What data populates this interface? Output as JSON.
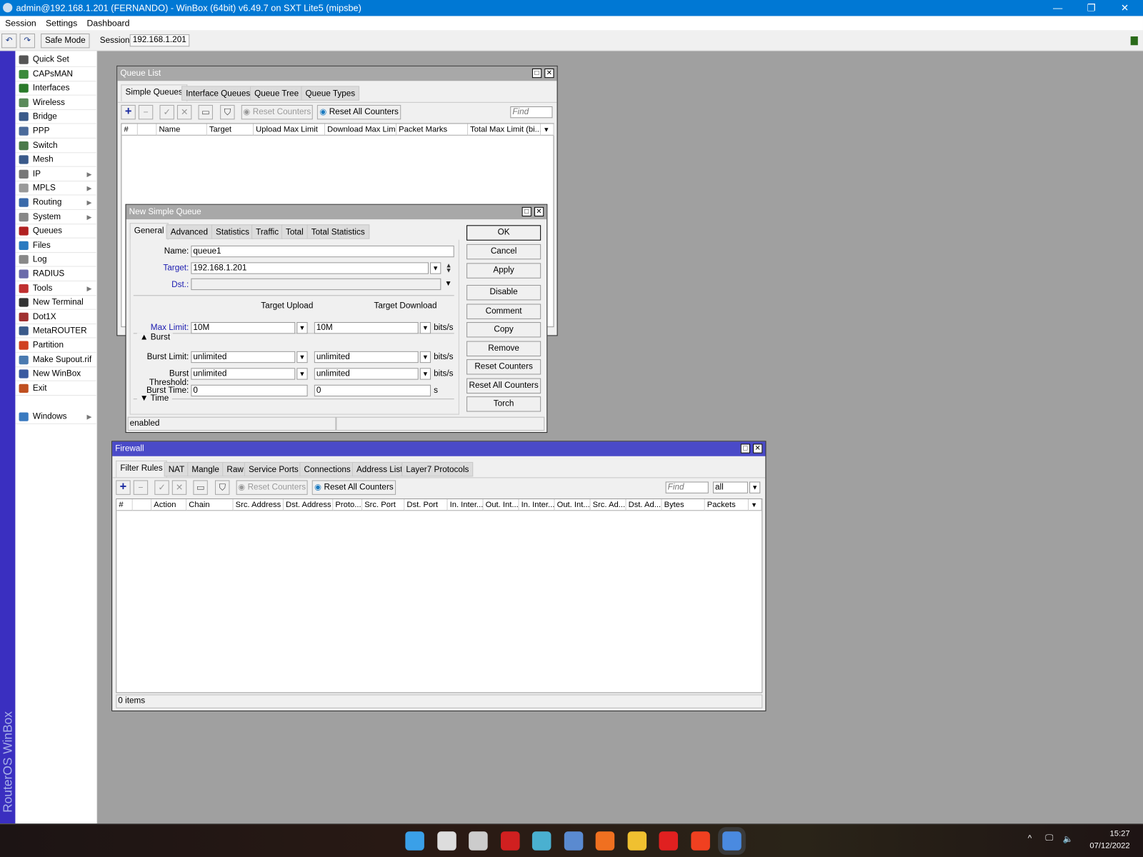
{
  "app": {
    "title": "admin@192.168.1.201 (FERNANDO) - WinBox (64bit) v6.49.7 on SXT Lite5 (mipsbe)",
    "menu": [
      "Session",
      "Settings",
      "Dashboard"
    ],
    "safe_mode": "Safe Mode",
    "session_label": "Session:",
    "session_value": "192.168.1.201",
    "brand": "RouterOS WinBox"
  },
  "sidebar": {
    "items": [
      {
        "label": "Quick Set",
        "icon": "wand-icon",
        "color": "#555"
      },
      {
        "label": "CAPsMAN",
        "icon": "antenna-icon",
        "color": "#3a8a3a"
      },
      {
        "label": "Interfaces",
        "icon": "interfaces-icon",
        "color": "#2a7a2a"
      },
      {
        "label": "Wireless",
        "icon": "wireless-icon",
        "color": "#5a8a5a"
      },
      {
        "label": "Bridge",
        "icon": "bridge-icon",
        "color": "#3a5a8a"
      },
      {
        "label": "PPP",
        "icon": "ppp-icon",
        "color": "#4a6a9a"
      },
      {
        "label": "Switch",
        "icon": "switch-icon",
        "color": "#4a7a4a"
      },
      {
        "label": "Mesh",
        "icon": "mesh-icon",
        "color": "#3a5a8a"
      },
      {
        "label": "IP",
        "icon": "ip-icon",
        "color": "#777",
        "sub": true
      },
      {
        "label": "MPLS",
        "icon": "mpls-icon",
        "color": "#999",
        "sub": true
      },
      {
        "label": "Routing",
        "icon": "routing-icon",
        "color": "#3a6aaa",
        "sub": true
      },
      {
        "label": "System",
        "icon": "gear-icon",
        "color": "#888",
        "sub": true
      },
      {
        "label": "Queues",
        "icon": "queues-icon",
        "color": "#b02020"
      },
      {
        "label": "Files",
        "icon": "folder-icon",
        "color": "#2a7ac0"
      },
      {
        "label": "Log",
        "icon": "log-icon",
        "color": "#888"
      },
      {
        "label": "RADIUS",
        "icon": "radius-icon",
        "color": "#6a6aaa"
      },
      {
        "label": "Tools",
        "icon": "tools-icon",
        "color": "#c03030",
        "sub": true
      },
      {
        "label": "New Terminal",
        "icon": "terminal-icon",
        "color": "#333"
      },
      {
        "label": "Dot1X",
        "icon": "dot1x-icon",
        "color": "#a03030"
      },
      {
        "label": "MetaROUTER",
        "icon": "metarouter-icon",
        "color": "#3a5a8a"
      },
      {
        "label": "Partition",
        "icon": "partition-icon",
        "color": "#d04020"
      },
      {
        "label": "Make Supout.rif",
        "icon": "supout-icon",
        "color": "#4a7ab0"
      },
      {
        "label": "New WinBox",
        "icon": "winbox-icon",
        "color": "#3a5aa0"
      },
      {
        "label": "Exit",
        "icon": "exit-icon",
        "color": "#c05020"
      }
    ],
    "windows": {
      "label": "Windows",
      "icon": "windows-icon",
      "color": "#3a7ac0"
    }
  },
  "queue_list": {
    "title": "Queue List",
    "tabs": [
      "Simple Queues",
      "Interface Queues",
      "Queue Tree",
      "Queue Types"
    ],
    "reset_counters": "Reset Counters",
    "reset_all_counters": "Reset All Counters",
    "find_placeholder": "Find",
    "columns": [
      "#",
      "",
      "Name",
      "Target",
      "Upload Max Limit",
      "Download Max Limit",
      "Packet Marks",
      "Total Max Limit (bi..."
    ]
  },
  "new_queue": {
    "title": "New Simple Queue",
    "tabs": [
      "General",
      "Advanced",
      "Statistics",
      "Traffic",
      "Total",
      "Total Statistics"
    ],
    "name_label": "Name:",
    "name": "queue1",
    "target_label": "Target:",
    "target": "192.168.1.201",
    "dst_label": "Dst.:",
    "dst": "",
    "upload_header": "Target Upload",
    "download_header": "Target Download",
    "max_limit_label": "Max Limit:",
    "max_upload": "10M",
    "max_download": "10M",
    "unit": "bits/s",
    "burst_section": "Burst",
    "burst_limit_label": "Burst Limit:",
    "burst_limit_up": "unlimited",
    "burst_limit_down": "unlimited",
    "burst_threshold_label": "Burst Threshold:",
    "burst_threshold_up": "unlimited",
    "burst_threshold_down": "unlimited",
    "burst_time_label": "Burst Time:",
    "burst_time_up": "0",
    "burst_time_down": "0",
    "time_unit": "s",
    "time_section": "Time",
    "buttons": [
      "OK",
      "Cancel",
      "Apply",
      "Disable",
      "Comment",
      "Copy",
      "Remove",
      "Reset Counters",
      "Reset All Counters",
      "Torch"
    ],
    "status": "enabled"
  },
  "firewall": {
    "title": "Firewall",
    "tabs": [
      "Filter Rules",
      "NAT",
      "Mangle",
      "Raw",
      "Service Ports",
      "Connections",
      "Address Lists",
      "Layer7 Protocols"
    ],
    "reset_counters": "Reset Counters",
    "reset_all_counters": "Reset All Counters",
    "find_placeholder": "Find",
    "filter_value": "all",
    "columns": [
      "#",
      "",
      "Action",
      "Chain",
      "Src. Address",
      "Dst. Address",
      "Proto...",
      "Src. Port",
      "Dst. Port",
      "In. Inter...",
      "Out. Int...",
      "In. Inter...",
      "Out. Int...",
      "Src. Ad...",
      "Dst. Ad...",
      "Bytes",
      "Packets"
    ],
    "status": "0 items"
  },
  "taskbar": {
    "time": "15:27",
    "date": "07/12/2022",
    "apps": [
      {
        "icon": "start-icon",
        "color": "#3aa0e8"
      },
      {
        "icon": "search-icon",
        "color": "#ddd"
      },
      {
        "icon": "task-view-icon",
        "color": "#ccc"
      },
      {
        "icon": "recorder-icon",
        "color": "#d02020"
      },
      {
        "icon": "app-globe-icon",
        "color": "#4ab0d0"
      },
      {
        "icon": "virtualbox-icon",
        "color": "#5a8ad0"
      },
      {
        "icon": "firefox-icon",
        "color": "#f07020"
      },
      {
        "icon": "file-explorer-icon",
        "color": "#f0c030"
      },
      {
        "icon": "wps-icon",
        "color": "#e02020"
      },
      {
        "icon": "brave-icon",
        "color": "#f04020"
      },
      {
        "icon": "winbox-icon",
        "color": "#4a8ae0"
      }
    ]
  }
}
